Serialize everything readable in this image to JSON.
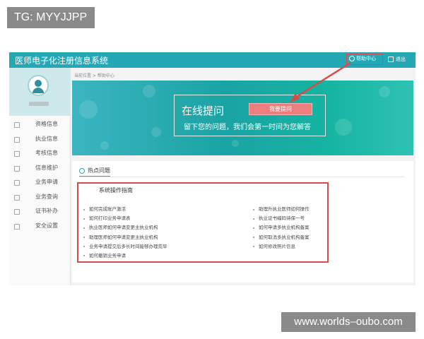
{
  "watermarks": {
    "top": "TG: MYYJJPP",
    "bottom": "www.worlds–oubo.com"
  },
  "header": {
    "title": "医师电子化注册信息系统",
    "help": "帮助中心",
    "logout": "退出"
  },
  "sidebar": {
    "items": [
      {
        "label": "资格信息",
        "icon": "certificate-icon"
      },
      {
        "label": "执业信息",
        "icon": "headset-icon"
      },
      {
        "label": "考核信息",
        "icon": "clipboard-icon"
      },
      {
        "label": "信息维护",
        "icon": "id-card-icon"
      },
      {
        "label": "业务申请",
        "icon": "edit-icon"
      },
      {
        "label": "业务查询",
        "icon": "search-icon"
      },
      {
        "label": "证书补办",
        "icon": "document-icon"
      },
      {
        "label": "安全设置",
        "icon": "user-lock-icon"
      }
    ]
  },
  "breadcrumb": "当前位置 > 帮助中心",
  "banner": {
    "title": "在线提问",
    "button": "我要提问",
    "subtitle": "留下您的问题，我们会第一时间为您解答"
  },
  "hot": {
    "tab": "热点问题",
    "guide_title": "系统操作指南",
    "left": [
      "如何完成账户激活",
      "如何打印业务申请表",
      "执业医师如何申请变更主执业机构",
      "助理医师如何申请变更主执业机构",
      "业务申请提交后多长时间能够办理完毕",
      "如何撤销业务申请"
    ],
    "right": [
      "助理升执业医师如何操作",
      "执业证书编码待保一号",
      "如何申请多执业机构备案",
      "如何取消多执业机构备案",
      "如何修改照片信息"
    ]
  },
  "colors": {
    "header": "#24a8b6",
    "highlight": "#d94a4a",
    "button": "#ee7e7e"
  }
}
